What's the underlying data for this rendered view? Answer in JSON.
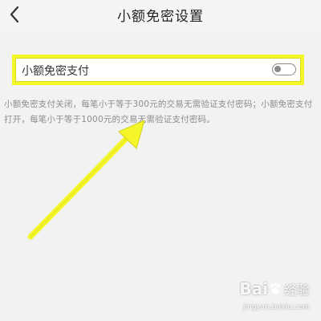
{
  "header": {
    "title": "小额免密设置",
    "back_icon": "chevron-left-icon"
  },
  "setting": {
    "label": "小额免密支付",
    "toggle_state": "off"
  },
  "description": {
    "text": "小额免密支付关闭，每笔小于等于300元的交易无需验证支付密码；小额免密支付打开，每笔小于等于1000元的交易无需验证支付密码。"
  },
  "annotation": {
    "highlight_color": "#f4f62a",
    "arrow_color": "#f4f62a"
  },
  "watermark": {
    "brand": "Bai",
    "brand_cn": "经验",
    "sub": "jingyan.baidu.com"
  }
}
